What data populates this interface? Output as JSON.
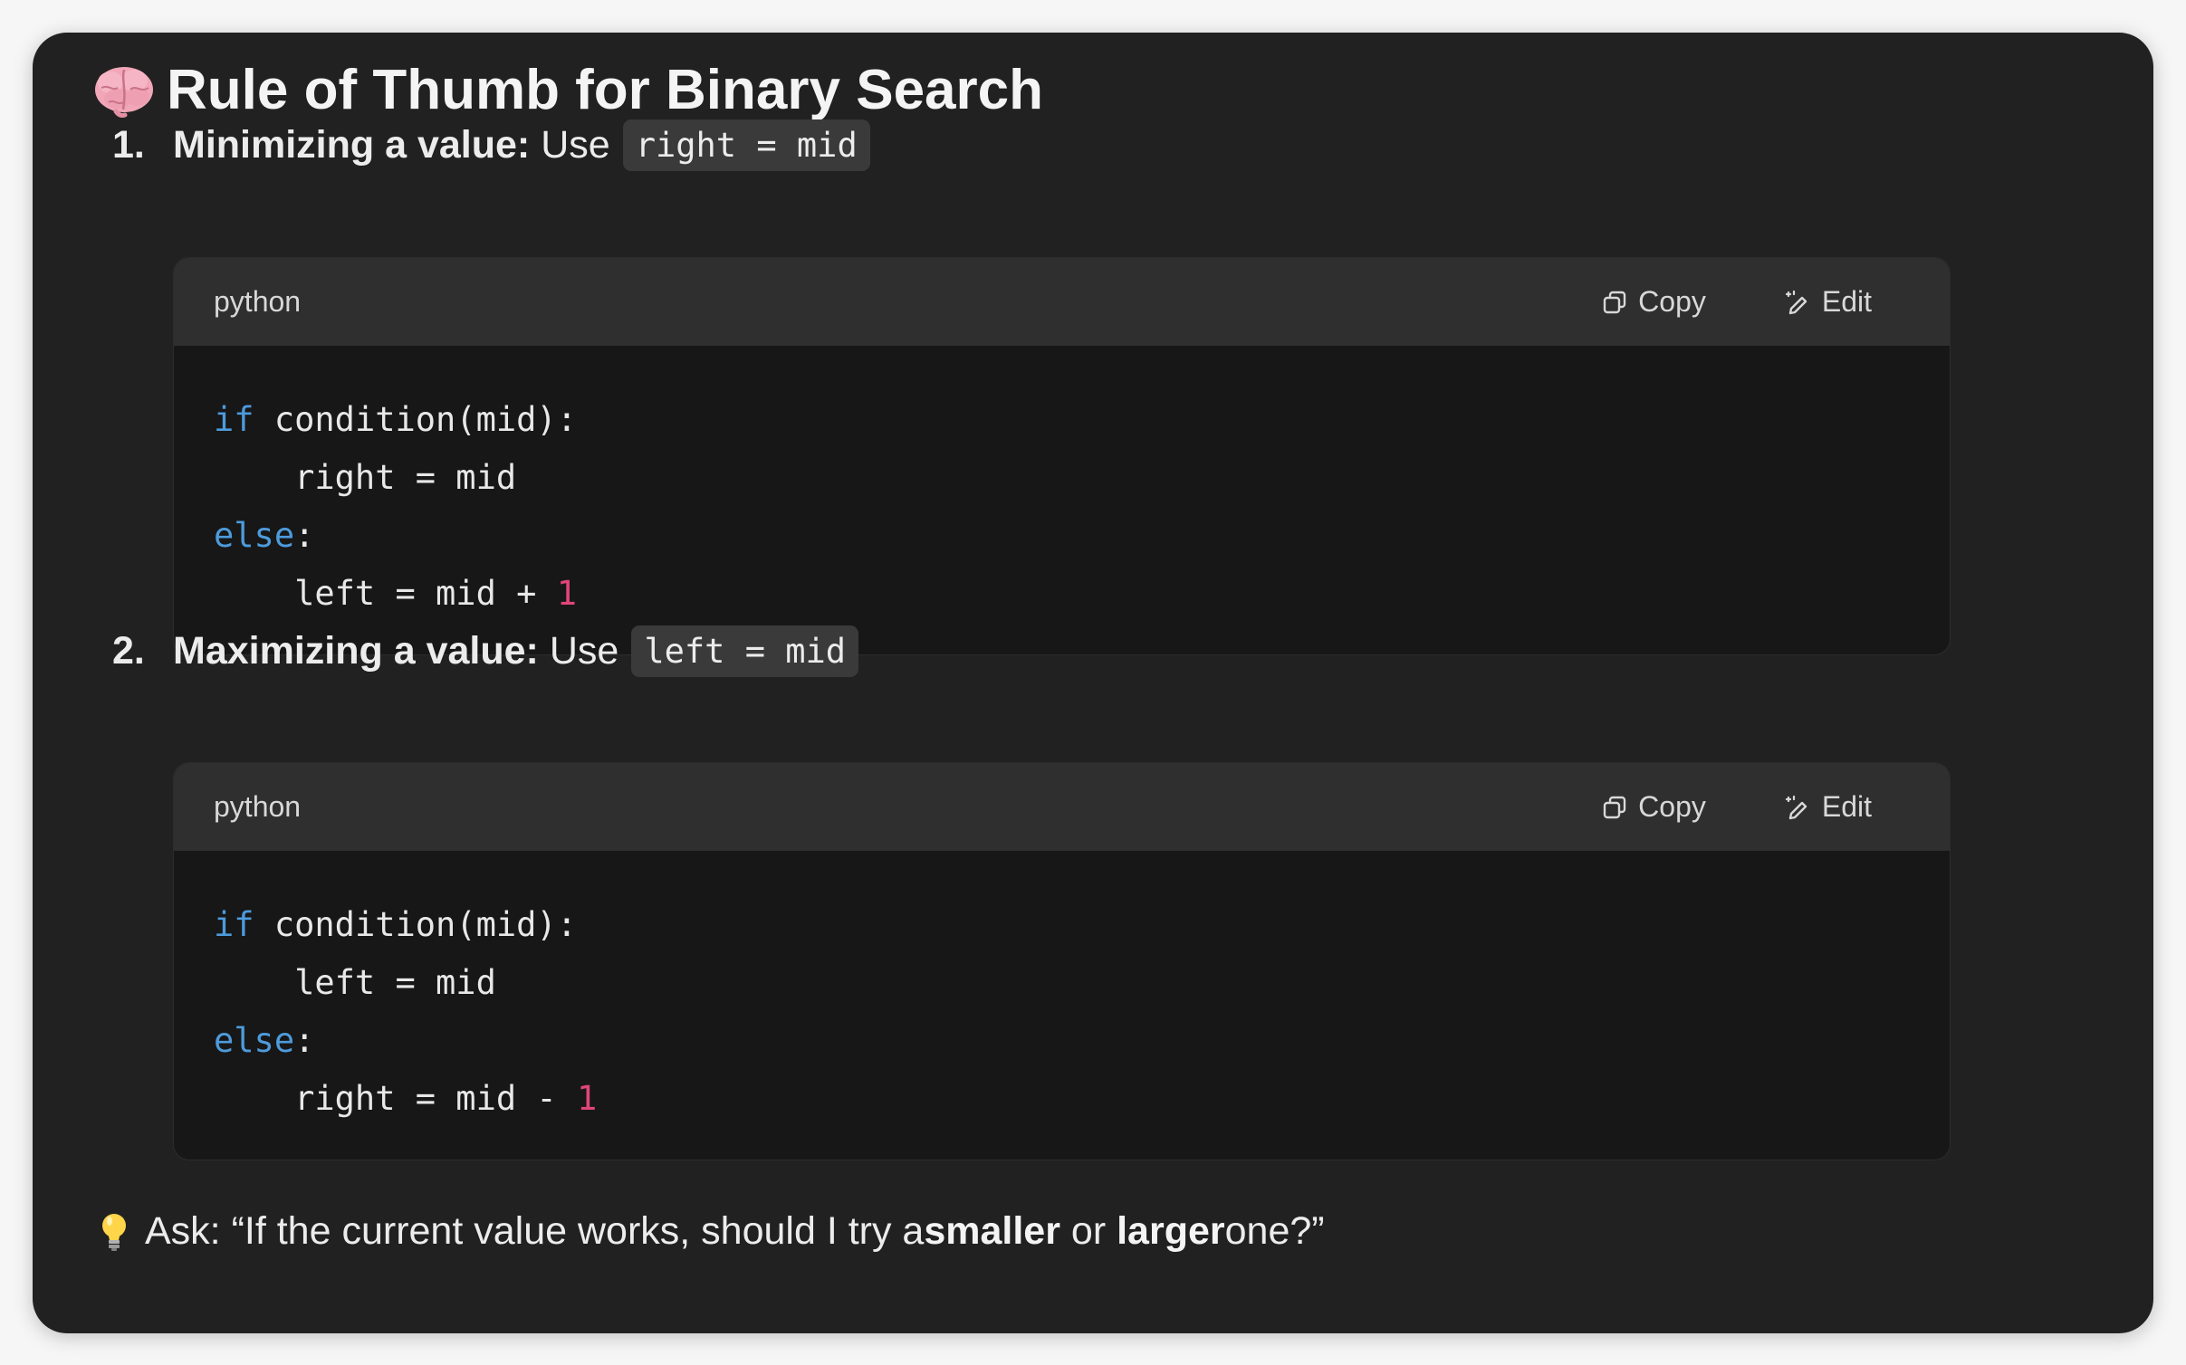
{
  "title": "Rule of Thumb for Binary Search",
  "title_emoji": "brain-icon",
  "items": [
    {
      "number": "1.",
      "strong": "Minimizing a value:",
      "rest": "Use",
      "inline_code": "right = mid",
      "code_block": {
        "language": "python",
        "copy_label": "Copy",
        "edit_label": "Edit",
        "lines": [
          {
            "kw": "if",
            "text": " condition(mid):"
          },
          {
            "text": "    right = mid"
          },
          {
            "kw": "else",
            "text": ":"
          },
          {
            "text": "    left = mid + ",
            "num": "1"
          }
        ]
      }
    },
    {
      "number": "2.",
      "strong": "Maximizing a value:",
      "rest": "Use",
      "inline_code": "left = mid",
      "code_block": {
        "language": "python",
        "copy_label": "Copy",
        "edit_label": "Edit",
        "lines": [
          {
            "kw": "if",
            "text": " condition(mid):"
          },
          {
            "text": "    left = mid"
          },
          {
            "kw": "else",
            "text": ":"
          },
          {
            "text": "    right = mid - ",
            "num": "1"
          }
        ]
      }
    }
  ],
  "tip": {
    "icon": "lightbulb-icon",
    "prefix": "Ask: “If the current value works, should I try a ",
    "bold1": "smaller",
    "middle": " or ",
    "bold2": "larger",
    "suffix": " one?”"
  },
  "colors": {
    "card_bg": "#212121",
    "code_header_bg": "#2f2f2f",
    "code_body_bg": "#171717",
    "keyword": "#4d9bdc",
    "number": "#e0457b"
  }
}
